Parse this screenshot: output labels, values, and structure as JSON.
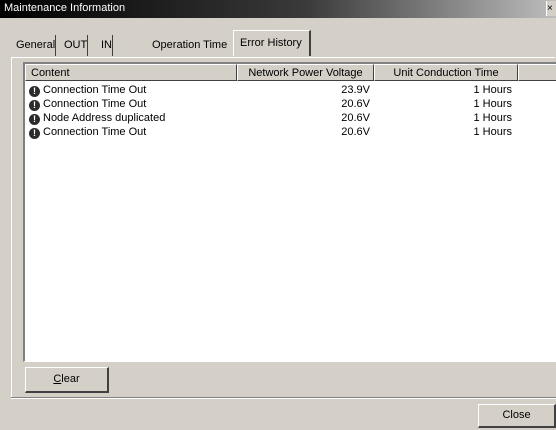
{
  "window": {
    "title": "Maintenance Information",
    "close_glyph": "×"
  },
  "tabs": [
    {
      "label": "General",
      "active": false
    },
    {
      "label": "OUT",
      "active": false
    },
    {
      "label": "IN",
      "active": false
    },
    {
      "label": "Operation Time",
      "active": false
    },
    {
      "label": "Error History",
      "active": true
    }
  ],
  "error_history": {
    "columns": [
      "Content",
      "Network Power Voltage",
      "Unit Conduction Time"
    ],
    "rows": [
      {
        "icon": "error-icon",
        "content": "Connection Time Out",
        "voltage": "23.9V",
        "time": "1 Hours"
      },
      {
        "icon": "error-icon",
        "content": "Connection Time Out",
        "voltage": "20.6V",
        "time": "1 Hours"
      },
      {
        "icon": "error-icon",
        "content": "Node Address duplicated",
        "voltage": "20.6V",
        "time": "1 Hours"
      },
      {
        "icon": "error-icon",
        "content": "Connection Time Out",
        "voltage": "20.6V",
        "time": "1 Hours"
      }
    ],
    "clear_button": {
      "label_accel": "C",
      "label_rest": "lear"
    }
  },
  "footer": {
    "close_button": "Close"
  }
}
